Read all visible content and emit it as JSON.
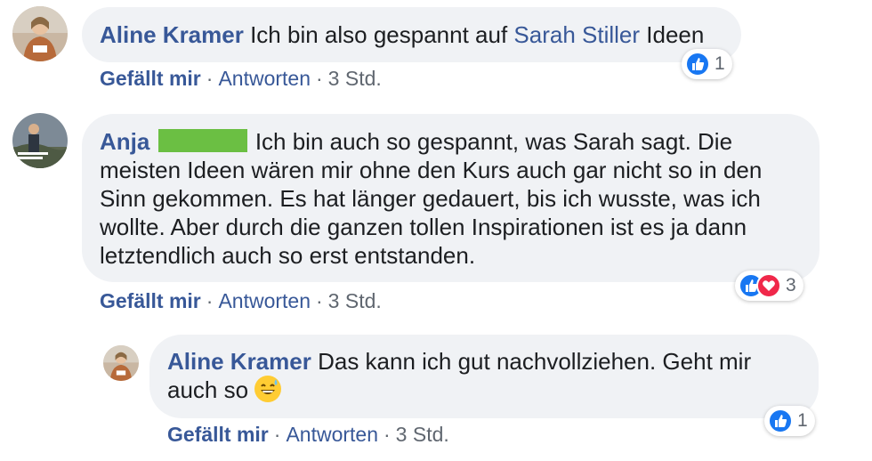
{
  "comments": [
    {
      "author": "Aline Kramer",
      "text_before": "Ich bin also gespannt auf",
      "mention": "Sarah Stiller",
      "text_after": "Ideen",
      "actions": {
        "like": "Gefällt mir",
        "sep": "·",
        "reply": "Antworten",
        "time": "3 Std."
      },
      "reactions": {
        "icons": [
          "like-icon"
        ],
        "count": "1"
      }
    },
    {
      "author": "Anja",
      "text": "Ich bin auch so gespannt, was Sarah sagt. Die meisten Ideen wären mir ohne den Kurs auch gar nicht so in den Sinn gekommen. Es hat länger gedauert, bis ich wusste, was ich wollte. Aber durch die ganzen tollen Inspirationen ist es ja dann letztendlich auch so erst entstanden.",
      "actions": {
        "like": "Gefällt mir",
        "sep": "·",
        "reply": "Antworten",
        "time": "3 Std."
      },
      "reactions": {
        "icons": [
          "like-icon",
          "love-icon"
        ],
        "count": "3"
      }
    },
    {
      "author": "Aline Kramer",
      "text": "Das kann ich gut nachvollziehen. Geht mir auch so",
      "emoji": "grinning-sweat-emoji",
      "actions": {
        "like": "Gefällt mir",
        "sep": "·",
        "reply": "Antworten",
        "time": "3 Std."
      },
      "reactions": {
        "icons": [
          "like-icon"
        ],
        "count": "1"
      }
    }
  ],
  "colors": {
    "name_link": "#385898",
    "bubble_bg": "#f0f2f5",
    "like_blue": "#1877f2",
    "love_red": "#f0284a",
    "redaction_green": "#6bbf43"
  }
}
